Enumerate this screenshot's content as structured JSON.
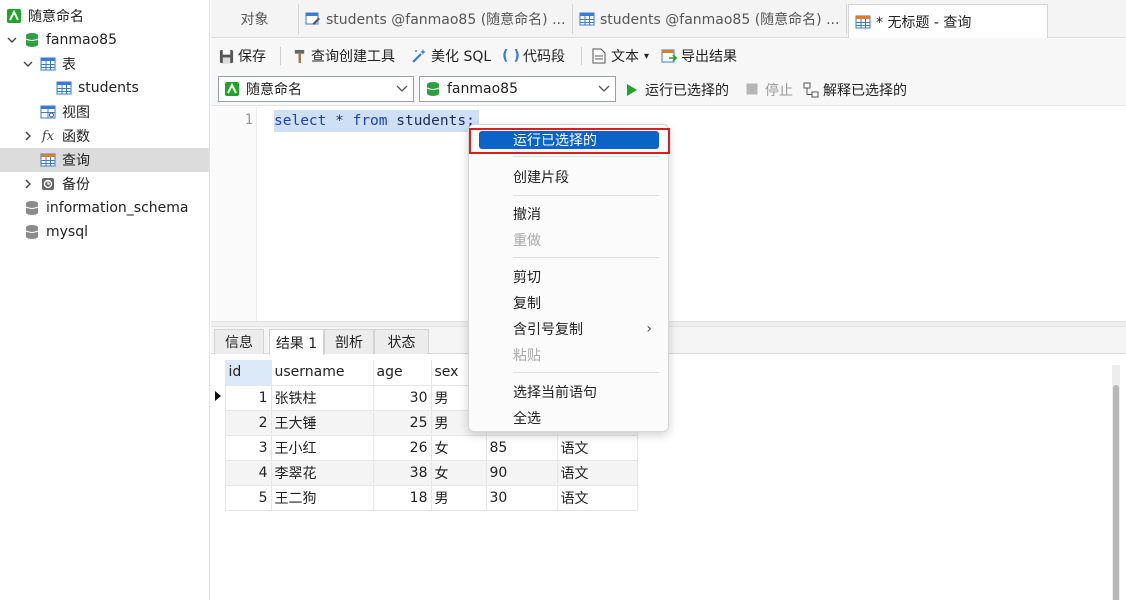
{
  "sidebar": {
    "connection": "随意命名",
    "database": "fanmao85",
    "tables_label": "表",
    "table_students": "students",
    "views_label": "视图",
    "functions_label": "函数",
    "queries_label": "查询",
    "backups_label": "备份",
    "db_information_schema": "information_schema",
    "db_mysql": "mysql",
    "function_icon_glyph": "fx"
  },
  "tabs": [
    {
      "label": "对象"
    },
    {
      "label": "students @fanmao85 (随意命名) ..."
    },
    {
      "label": "students @fanmao85 (随意命名) ..."
    },
    {
      "label": "* 无标题 - 查询"
    }
  ],
  "toolbar": {
    "save": "保存",
    "query_builder": "查询创建工具",
    "beautify_sql": "美化 SQL",
    "code_snippet": "代码段",
    "text": "文本",
    "export_results": "导出结果"
  },
  "connbar": {
    "connection_value": "随意命名",
    "database_value": "fanmao85",
    "run_selected": "运行已选择的",
    "stop": "停止",
    "explain_selected": "解释已选择的"
  },
  "editor": {
    "line_number": "1",
    "kw_select": "select",
    "op_star": " * ",
    "kw_from": "from",
    "table_text": " students;"
  },
  "result_tabs": {
    "info": "信息",
    "result1": "结果 1",
    "profile": "剖析",
    "status": "状态"
  },
  "grid": {
    "columns": [
      "id",
      "username",
      "age",
      "sex",
      "",
      ""
    ],
    "rows": [
      {
        "id": "1",
        "username": "张铁柱",
        "age": "30",
        "sex": "男",
        "c5": "",
        "c6": ""
      },
      {
        "id": "2",
        "username": "王大锤",
        "age": "25",
        "sex": "男",
        "c5": "",
        "c6": ""
      },
      {
        "id": "3",
        "username": "王小红",
        "age": "26",
        "sex": "女",
        "c5": "85",
        "c6": "语文"
      },
      {
        "id": "4",
        "username": "李翠花",
        "age": "38",
        "sex": "女",
        "c5": "90",
        "c6": "语文"
      },
      {
        "id": "5",
        "username": "王二狗",
        "age": "18",
        "sex": "男",
        "c5": "30",
        "c6": "语文"
      }
    ]
  },
  "context_menu": {
    "run_selected": "运行已选择的",
    "create_snippet": "创建片段",
    "undo": "撤消",
    "redo": "重做",
    "cut": "剪切",
    "copy": "复制",
    "copy_with_quotes": "含引号复制",
    "paste": "粘贴",
    "select_current_statement": "选择当前语句",
    "select_all": "全选",
    "submenu_arrow": "›"
  },
  "colors": {
    "highlight": "#0a64c8",
    "annotation_box": "#d62020",
    "run_green": "#1fa42a",
    "db_green": "#2ea043"
  }
}
